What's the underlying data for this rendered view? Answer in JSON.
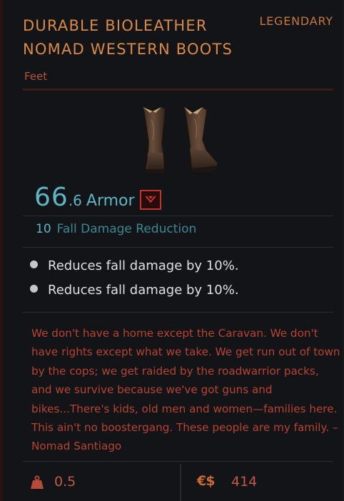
{
  "item": {
    "name_line1": "DURABLE BIOLEATHER",
    "name_line2": "NOMAD WESTERN BOOTS",
    "rarity": "LEGENDARY",
    "slot": "Feet",
    "image_icon": "cowboy-boots-icon"
  },
  "armor": {
    "value_int": "66",
    "value_dec": ".6",
    "label": "Armor",
    "compare_icon": "stat-decrease-icon",
    "compare_color": "#c0342a"
  },
  "stats": [
    {
      "value": "10",
      "label": "Fall Damage Reduction"
    }
  ],
  "mods": [
    {
      "text": "Reduces fall damage by 10%."
    },
    {
      "text": "Reduces fall damage by 10%."
    }
  ],
  "lore": {
    "text": "We don't have a home except the Caravan. We don't have rights except what we take. We get run out of town by the cops; we get raided by the roadwarrior packs, and we survive because we've got guns and bikes...There's kids, old men and women—families here. This ain't no boostergang. These people are my family. – Nomad Santiago"
  },
  "footer": {
    "weight_icon": "weight-icon",
    "weight": "0.5",
    "currency_symbol": "€$",
    "price": "414"
  },
  "colors": {
    "accent_orange": "#d98a4a",
    "lore_red": "#b84332",
    "stat_cyan": "#5eb5c3",
    "background": "#131417"
  }
}
